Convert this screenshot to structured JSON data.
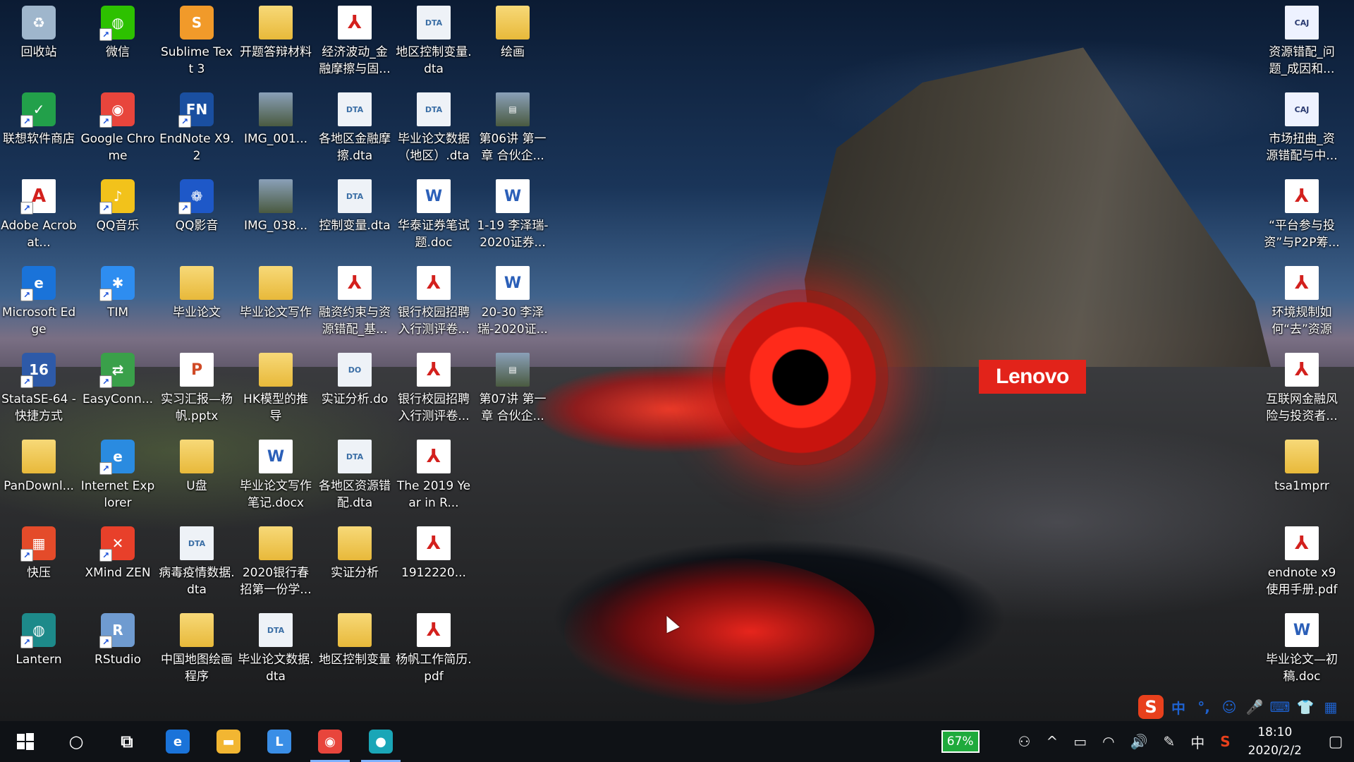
{
  "colors": {
    "taskbar_bg": "#0f1216",
    "battery_green": "#1faa3c",
    "lenovo_red": "#e2231a",
    "ime_blue": "#1e62d0"
  },
  "wallpaper": {
    "brand": "Lenovo"
  },
  "desktop": {
    "columns": [
      {
        "items": [
          {
            "label": "回收站",
            "icon": "recycle-bin-icon",
            "glyph": "♻",
            "color": "#9fb6cc",
            "type": "app"
          },
          {
            "label": "联想软件商店",
            "icon": "lenovo-store-icon",
            "glyph": "✓",
            "color": "#22a04a",
            "type": "shortcut"
          },
          {
            "label": "Adobe Acrobat...",
            "icon": "adobe-acrobat-icon",
            "glyph": "A",
            "color": "#ffffff",
            "type": "pdfapp"
          },
          {
            "label": "Microsoft Edge",
            "icon": "edge-icon",
            "glyph": "e",
            "color": "#1a73d9",
            "type": "shortcut"
          },
          {
            "label": "StataSE-64 - 快捷方式",
            "icon": "stata-icon",
            "glyph": "16",
            "color": "#2e5aa8",
            "type": "shortcut"
          },
          {
            "label": "PanDownl...",
            "icon": "folder-icon",
            "glyph": "",
            "color": "",
            "type": "folder"
          },
          {
            "label": "快压",
            "icon": "kuaiya-icon",
            "glyph": "▦",
            "color": "#e44b2a",
            "type": "shortcut"
          },
          {
            "label": "Lantern",
            "icon": "lantern-icon",
            "glyph": "◍",
            "color": "#1d8a8a",
            "type": "shortcut"
          }
        ]
      },
      {
        "items": [
          {
            "label": "微信",
            "icon": "wechat-icon",
            "glyph": "◍",
            "color": "#2dc100",
            "type": "shortcut"
          },
          {
            "label": "Google Chrome",
            "icon": "chrome-icon",
            "glyph": "◉",
            "color": "#e8453c",
            "type": "shortcut"
          },
          {
            "label": "QQ音乐",
            "icon": "qq-music-icon",
            "glyph": "♪",
            "color": "#f2c21b",
            "type": "shortcut"
          },
          {
            "label": "TIM",
            "icon": "tim-icon",
            "glyph": "✱",
            "color": "#2e8df0",
            "type": "shortcut"
          },
          {
            "label": "EasyConn...",
            "icon": "easyconnect-icon",
            "glyph": "⇄",
            "color": "#3aa04a",
            "type": "shortcut"
          },
          {
            "label": "Internet Explorer",
            "icon": "internet-explorer-icon",
            "glyph": "e",
            "color": "#2a8be0",
            "type": "shortcut"
          },
          {
            "label": "XMind ZEN",
            "icon": "xmind-icon",
            "glyph": "✕",
            "color": "#e8402a",
            "type": "shortcut"
          },
          {
            "label": "RStudio",
            "icon": "rstudio-icon",
            "glyph": "R",
            "color": "#6f9bd0",
            "type": "shortcut"
          }
        ]
      },
      {
        "items": [
          {
            "label": "Sublime Text 3",
            "icon": "sublime-text-icon",
            "glyph": "S",
            "color": "#f19a2a",
            "type": "app"
          },
          {
            "label": "EndNote X9.2",
            "icon": "endnote-icon",
            "glyph": "FN",
            "color": "#1a4fa0",
            "type": "shortcut"
          },
          {
            "label": "QQ影音",
            "icon": "qq-player-icon",
            "glyph": "❁",
            "color": "#1e58c8",
            "type": "shortcut"
          },
          {
            "label": "毕业论文",
            "icon": "folder-icon",
            "glyph": "",
            "color": "",
            "type": "folder"
          },
          {
            "label": "实习汇报—杨帆.pptx",
            "icon": "powerpoint-file-icon",
            "glyph": "P",
            "color": "",
            "type": "ppt"
          },
          {
            "label": "U盘",
            "icon": "folder-icon",
            "glyph": "",
            "color": "",
            "type": "folder"
          },
          {
            "label": "病毒疫情数据.dta",
            "icon": "dta-file-icon",
            "glyph": "DTA",
            "color": "",
            "type": "dta"
          },
          {
            "label": "中国地图绘画程序",
            "icon": "folder-icon",
            "glyph": "",
            "color": "",
            "type": "folder"
          }
        ]
      },
      {
        "items": [
          {
            "label": "开题答辩材料",
            "icon": "folder-icon",
            "glyph": "",
            "color": "",
            "type": "folder"
          },
          {
            "label": "IMG_001...",
            "icon": "image-file-icon",
            "glyph": "",
            "color": "",
            "type": "img"
          },
          {
            "label": "IMG_038...",
            "icon": "image-file-icon",
            "glyph": "",
            "color": "",
            "type": "img"
          },
          {
            "label": "毕业论文写作",
            "icon": "folder-icon",
            "glyph": "",
            "color": "",
            "type": "folder"
          },
          {
            "label": "HK模型的推导",
            "icon": "folder-icon",
            "glyph": "",
            "color": "",
            "type": "folder"
          },
          {
            "label": "毕业论文写作笔记.docx",
            "icon": "word-file-icon",
            "glyph": "W",
            "color": "",
            "type": "word"
          },
          {
            "label": "2020银行春招第一份学...",
            "icon": "folder-icon",
            "glyph": "",
            "color": "",
            "type": "folder"
          },
          {
            "label": "毕业论文数据.dta",
            "icon": "dta-file-icon",
            "glyph": "DTA",
            "color": "",
            "type": "dta"
          }
        ]
      },
      {
        "items": [
          {
            "label": "经济波动_金融摩擦与固...",
            "icon": "pdf-file-icon",
            "glyph": "⅄",
            "color": "",
            "type": "pdf"
          },
          {
            "label": "各地区金融摩擦.dta",
            "icon": "dta-file-icon",
            "glyph": "DTA",
            "color": "",
            "type": "dta"
          },
          {
            "label": "控制变量.dta",
            "icon": "dta-file-icon",
            "glyph": "DTA",
            "color": "",
            "type": "dta"
          },
          {
            "label": "融资约束与资源错配_基...",
            "icon": "pdf-file-icon",
            "glyph": "⅄",
            "color": "",
            "type": "pdf"
          },
          {
            "label": "实证分析.do",
            "icon": "do-file-icon",
            "glyph": "DO",
            "color": "",
            "type": "dta"
          },
          {
            "label": "各地区资源错配.dta",
            "icon": "dta-file-icon",
            "glyph": "DTA",
            "color": "",
            "type": "dta"
          },
          {
            "label": "实证分析",
            "icon": "folder-icon",
            "glyph": "",
            "color": "",
            "type": "folder"
          },
          {
            "label": "地区控制变量",
            "icon": "folder-icon",
            "glyph": "",
            "color": "",
            "type": "folder"
          }
        ]
      },
      {
        "items": [
          {
            "label": "地区控制变量.dta",
            "icon": "dta-file-icon",
            "glyph": "DTA",
            "color": "",
            "type": "dta"
          },
          {
            "label": "毕业论文数据（地区）.dta",
            "icon": "dta-file-icon",
            "glyph": "DTA",
            "color": "",
            "type": "dta"
          },
          {
            "label": "华泰证券笔试题.doc",
            "icon": "word-file-icon",
            "glyph": "W",
            "color": "",
            "type": "word"
          },
          {
            "label": "银行校园招聘入行测评卷...",
            "icon": "pdf-file-icon",
            "glyph": "⅄",
            "color": "",
            "type": "pdf"
          },
          {
            "label": "银行校园招聘入行测评卷...",
            "icon": "pdf-file-icon",
            "glyph": "⅄",
            "color": "",
            "type": "pdf"
          },
          {
            "label": "The 2019 Year in R...",
            "icon": "pdf-file-icon",
            "glyph": "⅄",
            "color": "",
            "type": "pdf"
          },
          {
            "label": "1912220...",
            "icon": "pdf-file-icon",
            "glyph": "⅄",
            "color": "",
            "type": "pdf"
          },
          {
            "label": "杨帆工作简历.pdf",
            "icon": "pdf-file-icon",
            "glyph": "⅄",
            "color": "",
            "type": "pdf"
          }
        ]
      },
      {
        "items": [
          {
            "label": "绘画",
            "icon": "folder-icon",
            "glyph": "",
            "color": "",
            "type": "folder"
          },
          {
            "label": "第06讲 第一章 合伙企...",
            "icon": "video-file-icon",
            "glyph": "▤",
            "color": "",
            "type": "img"
          },
          {
            "label": "1-19 李泽瑞-2020证券...",
            "icon": "word-file-icon",
            "glyph": "W",
            "color": "",
            "type": "word"
          },
          {
            "label": "20-30 李泽瑞-2020证...",
            "icon": "word-file-icon",
            "glyph": "W",
            "color": "",
            "type": "word"
          },
          {
            "label": "第07讲 第一章 合伙企...",
            "icon": "video-file-icon",
            "glyph": "▤",
            "color": "",
            "type": "img"
          }
        ]
      }
    ],
    "right_column": [
      {
        "label": "资源错配_问题_成因和...",
        "icon": "caj-file-icon",
        "glyph": "CAJ",
        "type": "txt"
      },
      {
        "label": "市场扭曲_资源错配与中...",
        "icon": "caj-file-icon",
        "glyph": "CAJ",
        "type": "txt"
      },
      {
        "label": "“平台参与投资”与P2P筹...",
        "icon": "pdf-file-icon",
        "glyph": "⅄",
        "type": "pdf"
      },
      {
        "label": "环境规制如何“去”资源错...",
        "icon": "pdf-file-icon",
        "glyph": "⅄",
        "type": "pdf"
      },
      {
        "label": "互联网金融风险与投资者...",
        "icon": "pdf-file-icon",
        "glyph": "⅄",
        "type": "pdf"
      },
      {
        "label": "tsa1mprr",
        "icon": "folder-icon",
        "glyph": "",
        "type": "folder"
      },
      {
        "label": "endnote x9 使用手册.pdf",
        "icon": "pdf-file-icon",
        "glyph": "⅄",
        "type": "pdf"
      },
      {
        "label": "毕业论文—初稿.doc",
        "icon": "word-file-icon",
        "glyph": "W",
        "type": "word"
      }
    ]
  },
  "ime": {
    "logo": "S",
    "items": [
      "中",
      "°,",
      "☺",
      "🎤",
      "⌨",
      "👕",
      "▦"
    ]
  },
  "taskbar": {
    "start_icon": "windows-start-icon",
    "pinned": [
      {
        "name": "cortana-search",
        "glyph": "○",
        "color": "",
        "active": false
      },
      {
        "name": "task-view",
        "glyph": "⧉",
        "color": "",
        "active": false
      },
      {
        "name": "edge",
        "glyph": "e",
        "color": "#1a73d9",
        "active": false
      },
      {
        "name": "file-explorer",
        "glyph": "▬",
        "color": "#f2b632",
        "active": false
      },
      {
        "name": "clock-app",
        "glyph": "L",
        "color": "#3a8ee6",
        "active": false
      },
      {
        "name": "chrome",
        "glyph": "◉",
        "color": "#e8453c",
        "active": true
      },
      {
        "name": "screen-recorder",
        "glyph": "●",
        "color": "#1aa6b7",
        "active": true
      }
    ],
    "tray": {
      "battery_percent": "67%",
      "people": "⚇",
      "chevron": "^",
      "battery_icon": "▭",
      "wifi": "◠",
      "volume": "🔊",
      "pen": "✎",
      "input_lang": "中",
      "sogou": "S",
      "time": "18:10",
      "date": "2020/2/2",
      "notification": "▢"
    }
  }
}
